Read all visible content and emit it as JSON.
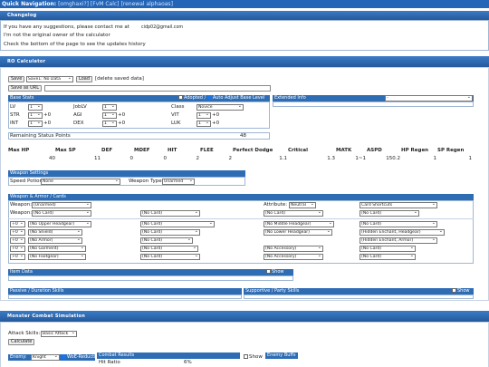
{
  "quick_nav": {
    "label": "Quick Navigation:",
    "links": [
      "[omghaxi?]",
      "[FvM Calc]",
      "[renewal alphaoas]"
    ]
  },
  "changelog": {
    "title": "Changelog",
    "line1": "If you have any suggestions, please contact me at",
    "email": "cidp02@gmail.com",
    "line2": "I'm not the original owner of the calculator",
    "line3": "Check the bottom of the page to see the updates history"
  },
  "ro_calc": {
    "title": "RO Calculator",
    "save_btn": "Save",
    "save_slot": "Save1: No Data",
    "load_btn": "Load",
    "delete_link": "[delete saved data]",
    "save_url_btn": "Save as URL",
    "base_stats": {
      "header": "Base Stats",
      "adopted": "Adopted /",
      "auto_adjust": "Auto Adjust Base Level",
      "lv_label": "LV",
      "lv": "1",
      "joblv_label": "JobLV",
      "joblv": "1",
      "class_label": "Class",
      "class": "Novice",
      "stats": [
        {
          "n": "STR",
          "v": "1",
          "b": "+0"
        },
        {
          "n": "AGI",
          "v": "1",
          "b": "+0"
        },
        {
          "n": "VIT",
          "v": "1",
          "b": "+0"
        },
        {
          "n": "INT",
          "v": "1",
          "b": "+0"
        },
        {
          "n": "DEX",
          "v": "1",
          "b": "+0"
        },
        {
          "n": "LUK",
          "v": "1",
          "b": "+0"
        }
      ],
      "remaining_label": "Remaining Status Points",
      "remaining": "48"
    },
    "extended_info": {
      "header": "Extended Info",
      "value": "-"
    },
    "summary_headers": [
      "Max HP",
      "Max SP",
      "DEF",
      "MDEF",
      "HIT",
      "FLEE",
      "Perfect Dodge",
      "Critical",
      "MATK",
      "ASPD",
      "HP Regen",
      "SP Regen"
    ],
    "summary_values": [
      "40",
      "11",
      "0",
      "0",
      "2",
      "2",
      "1.1",
      "1.3",
      "1~1",
      "150.2",
      "1",
      "1"
    ],
    "weapon_settings": {
      "header": "Weapon Settings",
      "speed_label": "Speed Potion:",
      "speed": "None",
      "type_label": "Weapon Type:",
      "type": "Unarmed"
    },
    "armor": {
      "header": "Weapon & Armor / Cards",
      "weapon_label": "Weapon:",
      "weapon": "(Unarmed)",
      "weapon2_label": "Weapon:",
      "weapon2": "(No Card)",
      "attr_label": "Attribute:",
      "attr": "Neutral",
      "card_shortcuts": "Card Shortcuts",
      "card_row1": [
        "(No Card)",
        "(No Card)",
        "(No Card)"
      ],
      "rows": [
        {
          "ref": "+0",
          "item": "(No Upper Headgear)",
          "card": "(No Card)",
          "item2": "(No Middle Headgear)",
          "card2": "(No Card)"
        },
        {
          "ref": "+0",
          "item": "(No Shield)",
          "card": "(No Card)",
          "item2": "(No Lower Headgear)",
          "card2": "(Hidden Enchant, Headgear)"
        },
        {
          "ref": "+0",
          "item": "(No Armor)",
          "card": "(No Card)",
          "item2": "",
          "card2": "(Hidden Enchant, Armor)"
        },
        {
          "ref": "+0",
          "item": "(No Garment)",
          "card": "(No Card)",
          "item2": "(No Accessory)",
          "card2": "(No Card)"
        },
        {
          "ref": "+0",
          "item": "(No Footgear)",
          "card": "(No Card)",
          "item2": "(No Accessory)",
          "card2": "(No Card)"
        }
      ]
    },
    "item_data": {
      "header": "Item Data",
      "show": "Show"
    },
    "passive": {
      "header": "Passive / Duration Skills"
    },
    "supportive": {
      "header": "Supportive / Party Skills",
      "show": "Show"
    }
  },
  "monster": {
    "title": "Monster Combat Simulation",
    "attack_label": "Attack Skills:",
    "attack": "Basic Attack",
    "calc_btn": "Calculate",
    "enemy_label": "Enemy:",
    "enemy": "Knight",
    "woe": "WoE-Reduction",
    "combat_header": "Combat Results",
    "hit_ratio_label": "Hit Ratio",
    "hit_ratio": "6%",
    "show": "Show",
    "enemy_buffs": "Enemy Buffs"
  }
}
